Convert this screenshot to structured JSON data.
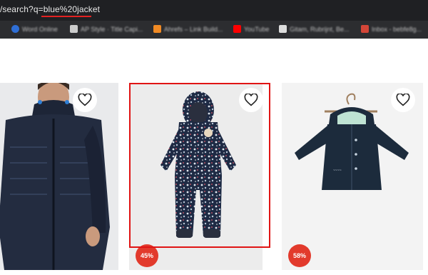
{
  "address_bar": {
    "url_prefix": "/search?q=",
    "query": "blue%20jacket"
  },
  "bookmarks": [
    {
      "label": "Word Online",
      "color": "#2f6fd6"
    },
    {
      "label": "AP Style · Title Capi...",
      "color": "#cccccc"
    },
    {
      "label": "Ahrefs – Link Build...",
      "color": "#f08a24"
    },
    {
      "label": "YouTube",
      "color": "#ff0000"
    },
    {
      "label": "Gitam, Rubrijnt, Be...",
      "color": "#dddddd"
    },
    {
      "label": "Inbox - bebfe8g...",
      "color": "#d44638"
    }
  ],
  "products": [
    {
      "name": "men-quilted-jacket",
      "discount": "",
      "wishlist_icon": "heart-icon"
    },
    {
      "name": "kids-floral-snowsuit",
      "discount": "45%",
      "wishlist_icon": "heart-icon"
    },
    {
      "name": "kids-navy-hooded-jacket",
      "discount": "58%",
      "wishlist_icon": "heart-icon"
    }
  ],
  "colors": {
    "highlight": "#e01414",
    "discount_badge": "#e23a2c",
    "browser_dark": "#1f2023"
  }
}
